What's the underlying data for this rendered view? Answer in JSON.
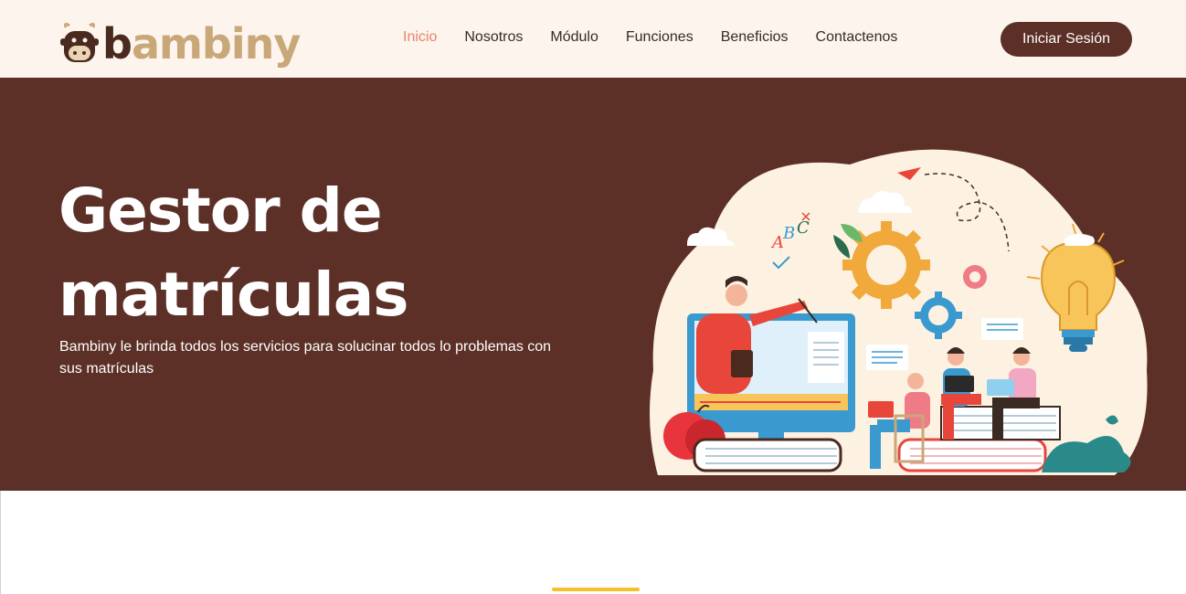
{
  "brand": {
    "name_prefix": "b",
    "name_rest": "ambiny"
  },
  "nav": {
    "items": [
      {
        "label": "Inicio",
        "active": true
      },
      {
        "label": "Nosotros"
      },
      {
        "label": "Módulo"
      },
      {
        "label": "Funciones"
      },
      {
        "label": "Beneficios"
      },
      {
        "label": "Contactenos"
      }
    ],
    "login_label": "Iniciar Sesión"
  },
  "hero": {
    "title_line1": "Gestor de",
    "title_line2": "matrículas",
    "subtitle": "Bambiny le brinda todos los servicios para solucinar todos lo problemas con sus matrículas"
  },
  "colors": {
    "header_bg": "#fdf4ee",
    "hero_bg": "#5c3027",
    "accent_active": "#e8836b",
    "accent_line": "#f5c02a"
  }
}
